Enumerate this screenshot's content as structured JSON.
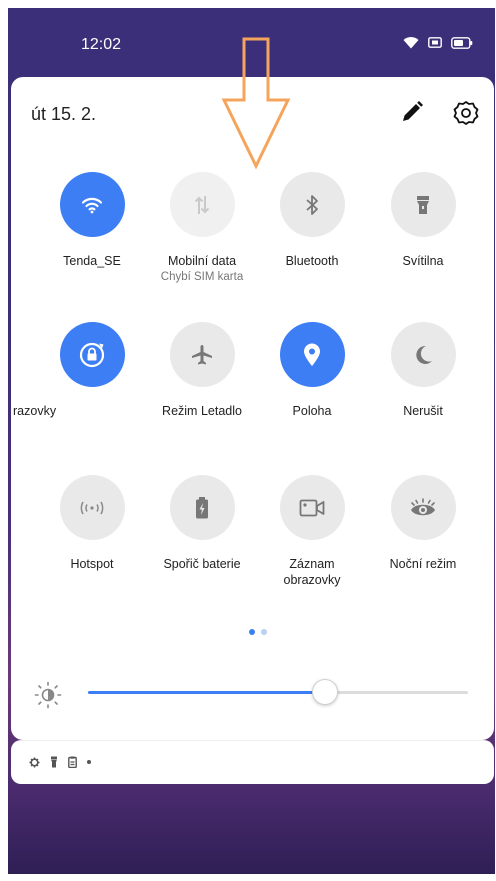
{
  "status_bar": {
    "time": "12:02"
  },
  "panel": {
    "date": "út 15. 2.",
    "tiles": [
      {
        "label": "Tenda_SE",
        "sub": "",
        "state": "on",
        "icon": "wifi-icon"
      },
      {
        "label": "Mobilní data",
        "sub": "Chybí SIM karta",
        "state": "disabled",
        "icon": "mobile-data-icon"
      },
      {
        "label": "Bluetooth",
        "sub": "",
        "state": "off",
        "icon": "bluetooth-icon"
      },
      {
        "label": "Svítilna",
        "sub": "",
        "state": "off",
        "icon": "flashlight-icon"
      },
      {
        "label": "razovky",
        "label_cut_prefix": "Z",
        "sub": "",
        "state": "on",
        "icon": "auto-rotate-icon"
      },
      {
        "label": "Režim Letadlo",
        "sub": "",
        "state": "off",
        "icon": "airplane-icon"
      },
      {
        "label": "Poloha",
        "sub": "",
        "state": "on",
        "icon": "location-icon"
      },
      {
        "label": "Nerušit",
        "sub": "",
        "state": "off",
        "icon": "moon-icon"
      },
      {
        "label": "Hotspot",
        "sub": "",
        "state": "off",
        "icon": "hotspot-icon"
      },
      {
        "label": "Spořič baterie",
        "sub": "",
        "state": "off",
        "icon": "battery-saver-icon"
      },
      {
        "label": "Záznam",
        "sub": "obrazovky",
        "state": "off",
        "icon": "screen-record-icon"
      },
      {
        "label": "Noční režim",
        "sub": "",
        "state": "off",
        "icon": "eye-icon"
      }
    ],
    "page_indicator": {
      "count": 2,
      "current": 1
    },
    "brightness": {
      "level": 0.62
    }
  },
  "colors": {
    "accent": "#3d7ef5",
    "tile_off": "#e9e9e9",
    "arrow": "#f5a45c"
  }
}
